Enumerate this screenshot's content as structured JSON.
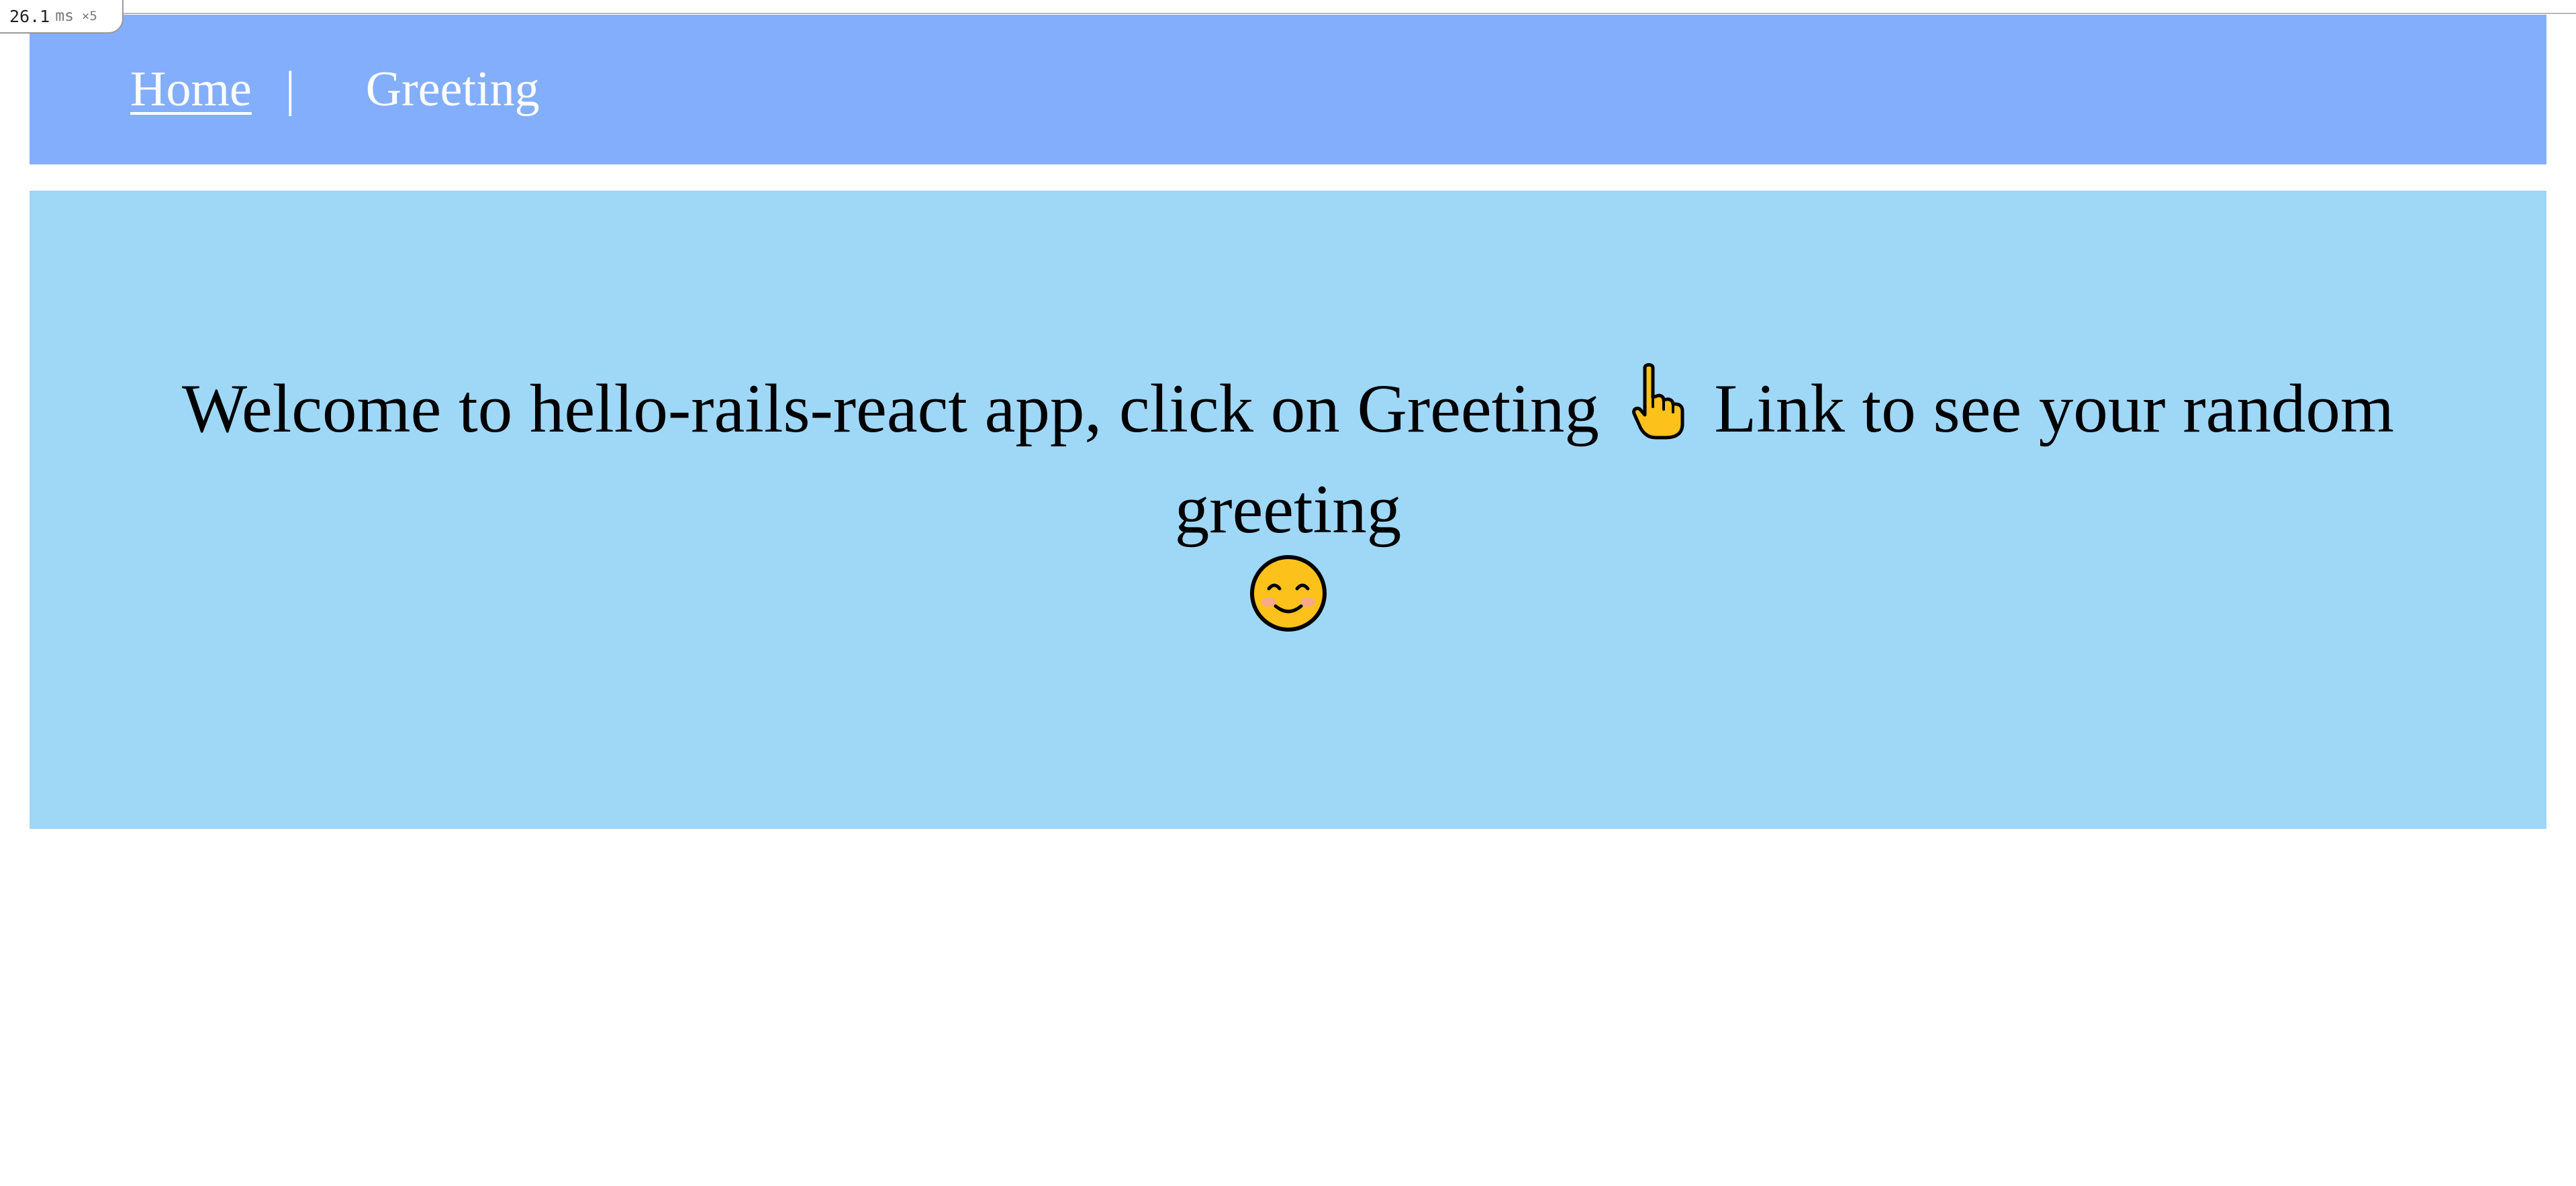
{
  "perf": {
    "value": "26.1",
    "unit": "ms",
    "count": "×5"
  },
  "nav": {
    "home_label": "Home",
    "separator": "|",
    "greeting_label": "Greeting"
  },
  "hero": {
    "text_before_icon": "Welcome to hello-rails-react app, click on Greeting",
    "text_after_icon": "Link to see your random greeting",
    "icons": [
      "pointing-up-hand-icon",
      "smiling-face-icon"
    ]
  },
  "colors": {
    "navbar_bg": "#83aefb",
    "hero_bg": "#9fd7f7",
    "nav_text": "#ffffff"
  }
}
